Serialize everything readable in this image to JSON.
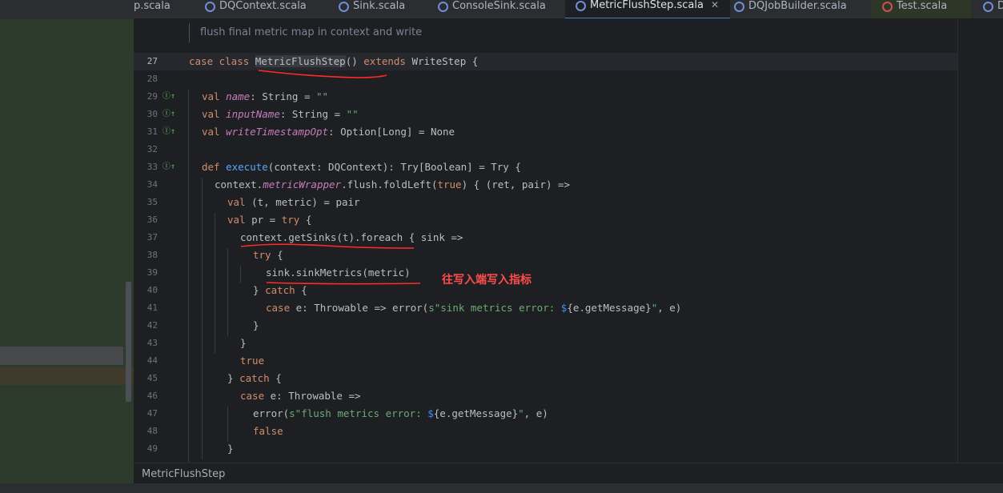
{
  "tabs": [
    {
      "label": "p.scala",
      "icon": "none",
      "active": false
    },
    {
      "label": "DQContext.scala",
      "icon": "scala-class-icon",
      "active": false
    },
    {
      "label": "Sink.scala",
      "icon": "scala-trait-icon",
      "active": false
    },
    {
      "label": "ConsoleSink.scala",
      "icon": "scala-class-icon",
      "active": false
    },
    {
      "label": "MetricFlushStep.scala",
      "icon": "scala-class-icon",
      "active": true
    },
    {
      "label": "DQJobBuilder.scala",
      "icon": "scala-class-icon",
      "active": false
    },
    {
      "label": "Test.scala",
      "icon": "scala-object-icon",
      "active": false
    },
    {
      "label": "D",
      "icon": "none",
      "active": false
    }
  ],
  "doc_comment": "flush final metric map in context and write",
  "line_numbers": [
    "27",
    "28",
    "29",
    "30",
    "31",
    "32",
    "33",
    "34",
    "35",
    "36",
    "37",
    "38",
    "39",
    "40",
    "41",
    "42",
    "43",
    "44",
    "45",
    "46",
    "47",
    "48",
    "49"
  ],
  "code": {
    "l27": {
      "k1": "case class ",
      "name": "MetricFlushStep",
      "p": "() ",
      "k2": "extends ",
      "rest": "WriteStep {"
    },
    "l29": {
      "k": "val ",
      "f": "name",
      "rest": ": String = ",
      "s": "\"\""
    },
    "l30": {
      "k": "val ",
      "f": "inputName",
      "rest": ": String = ",
      "s": "\"\""
    },
    "l31": {
      "k": "val ",
      "f": "writeTimestampOpt",
      "rest": ": Option[Long] = None"
    },
    "l33": {
      "k": "def ",
      "fn": "execute",
      "rest": "(context: DQContext): Try[Boolean] = Try {"
    },
    "l34": {
      "a": "context.",
      "f": "metricWrapper",
      "b": ".flush.foldLeft(",
      "k": "true",
      "c": ") { (ret, pair) =>"
    },
    "l35": {
      "k": "val ",
      "rest": "(t, metric) = pair"
    },
    "l36": {
      "k": "val ",
      "a": "pr = ",
      "k2": "try ",
      "b": "{"
    },
    "l37": {
      "text": "context.getSinks(t).foreach { sink =>"
    },
    "l38": {
      "k": "try ",
      "b": "{"
    },
    "l39": {
      "text": "sink.sinkMetrics(metric)"
    },
    "l40": {
      "a": "} ",
      "k": "catch ",
      "b": "{"
    },
    "l41": {
      "k": "case ",
      "a": "e: Throwable => error(",
      "s1": "s\"sink metrics error: ",
      "i1": "$",
      "b": "{e.getMessage}",
      "s2": "\"",
      "c": ", e)"
    },
    "l42": {
      "text": "}"
    },
    "l43": {
      "text": "}"
    },
    "l44": {
      "k": "true"
    },
    "l45": {
      "a": "} ",
      "k": "catch ",
      "b": "{"
    },
    "l46": {
      "k": "case ",
      "a": "e: Throwable =>"
    },
    "l47": {
      "a": "error(",
      "s1": "s\"flush metrics error: ",
      "i1": "$",
      "b": "{e.getMessage}",
      "s2": "\"",
      "c": ", e)"
    },
    "l48": {
      "k": "false"
    },
    "l49": {
      "text": "}"
    }
  },
  "annotation": "往写入端写入指标",
  "breadcrumb": "MetricFlushStep",
  "colors": {
    "annotation": "#ff4d4d",
    "keyword": "#cf8e6d",
    "function": "#56a8f5",
    "field": "#c77dbb",
    "string": "#6aab73"
  }
}
